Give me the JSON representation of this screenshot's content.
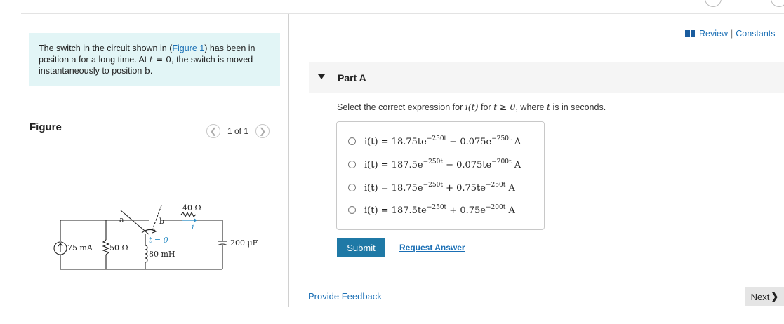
{
  "problem": {
    "text_1": "The switch in the circuit shown in (",
    "figure_link": "Figure 1",
    "text_2": ") has been in position a for a long time. At ",
    "t_var": "t",
    "eq": " = 0",
    "text_3": ", the switch is moved instantaneously to position ",
    "pos_b": "b",
    "text_4": "."
  },
  "figure": {
    "title": "Figure",
    "pager": "1 of 1",
    "prev_icon": "chevron-left-icon",
    "next_icon": "chevron-right-icon"
  },
  "circuit": {
    "source": "75 mA",
    "r1": "50 Ω",
    "node_a": "a",
    "node_b": "b",
    "switch_label": "t = 0",
    "inductor": "80 mH",
    "r2": "40 Ω",
    "current": "i",
    "capacitor": "200 μF"
  },
  "header": {
    "review": "Review",
    "sep": "|",
    "constants": "Constants"
  },
  "partA": {
    "title": "Part A",
    "question_1": "Select the correct expression for ",
    "question_i": "i(t)",
    "question_2": " for ",
    "question_cond": "t ≥ 0",
    "question_3": ", where ",
    "question_t": "t",
    "question_4": " is in seconds."
  },
  "options": [
    {
      "lhs": "i(t) = 18.75te",
      "e1": "−250t",
      "mid": " − 0.075e",
      "e2": "−250t",
      "unit": " A"
    },
    {
      "lhs": "i(t) = 187.5e",
      "e1": "−250t",
      "mid": " − 0.075te",
      "e2": "−200t",
      "unit": " A"
    },
    {
      "lhs": "i(t) = 18.75e",
      "e1": "−250t",
      "mid": " + 0.75te",
      "e2": "−250t",
      "unit": " A"
    },
    {
      "lhs": "i(t) = 187.5te",
      "e1": "−250t",
      "mid": " + 0.75e",
      "e2": "−200t",
      "unit": " A"
    }
  ],
  "actions": {
    "submit": "Submit",
    "request": "Request Answer",
    "feedback": "Provide Feedback",
    "next": "Next",
    "next_icon": "chevron-right-icon"
  },
  "colors": {
    "link": "#1a6fb5",
    "problem_bg": "#e2f5f6",
    "submit_bg": "#1f79a6"
  }
}
